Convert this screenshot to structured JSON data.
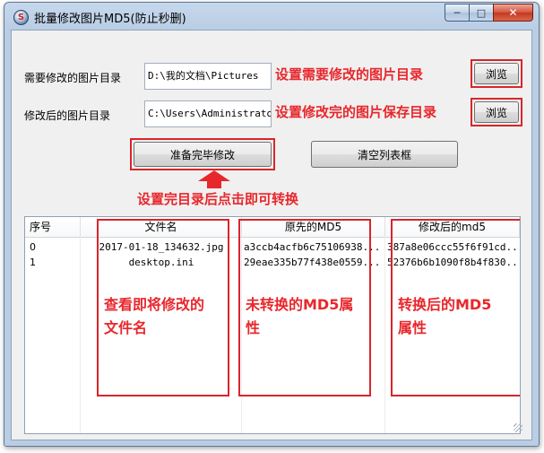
{
  "window": {
    "title": "批量修改图片MD5(防止秒删)",
    "icon_glyph": "S",
    "controls": {
      "minimize": "─",
      "maximize": "□",
      "close": "✕"
    }
  },
  "source_dir": {
    "label": "需要修改的图片目录",
    "value": "D:\\我的文档\\Pictures",
    "browse_label": "浏览",
    "annotation": "设置需要修改的图片目录"
  },
  "output_dir": {
    "label": "修改后的图片目录",
    "value": "C:\\Users\\Administrator",
    "browse_label": "浏览",
    "annotation": "设置修改完的图片保存目录"
  },
  "actions": {
    "start_label": "准备完毕修改",
    "clear_label": "清空列表框",
    "annotation": "设置完目录后点击即可转换"
  },
  "table": {
    "columns": [
      "序号",
      "文件名",
      "原先的MD5",
      "修改后的md5"
    ],
    "rows": [
      {
        "index": "0",
        "filename": "2017-01-18_134632.jpg",
        "md5_before": "a3ccb4acfb6c75106938...",
        "md5_after": "387a8e06ccc55f6f91cd..."
      },
      {
        "index": "1",
        "filename": "desktop.ini",
        "md5_before": "29eae335b77f438e0559...",
        "md5_after": "52376b6b1090f8b4f830..."
      }
    ]
  },
  "annotations": {
    "filename_note_line1": "查看即将修改的",
    "filename_note_line2": "文件名",
    "before_note_line1": "未转换的MD5属",
    "before_note_line2": "性",
    "after_note_line1": "转换后的MD5",
    "after_note_line2": "属性"
  },
  "colors": {
    "annotation_red": "#e8272c",
    "title_bar": "#b9cde4"
  }
}
